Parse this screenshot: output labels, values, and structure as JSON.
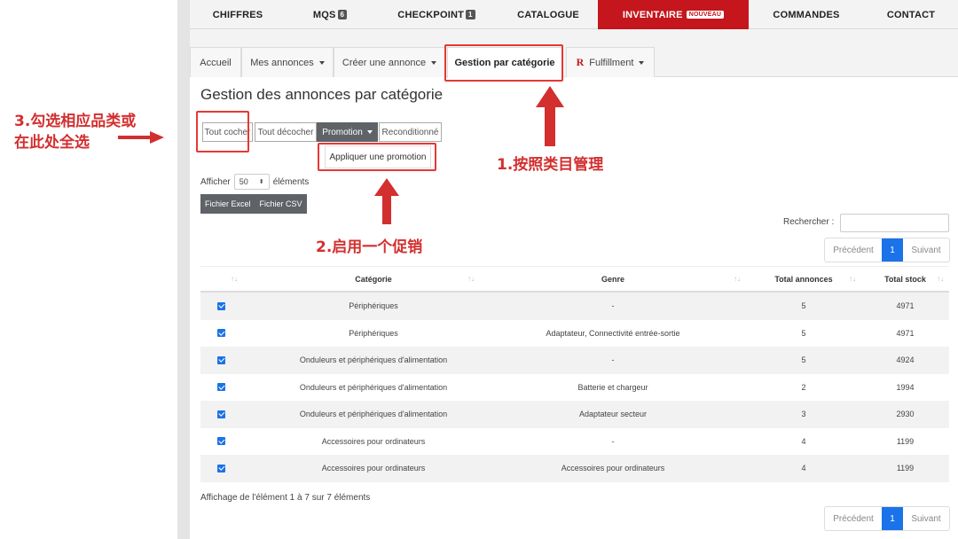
{
  "nav": {
    "items": [
      {
        "label": "CHIFFRES",
        "badge": ""
      },
      {
        "label": "MQS",
        "badge": "6"
      },
      {
        "label": "CHECKPOINT",
        "badge": "1"
      },
      {
        "label": "CATALOGUE",
        "badge": ""
      },
      {
        "label": "INVENTAIRE",
        "badge": "NOUVEAU"
      },
      {
        "label": "COMMANDES",
        "badge": ""
      },
      {
        "label": "CONTACT",
        "badge": ""
      }
    ]
  },
  "tabs": [
    {
      "label": "Accueil"
    },
    {
      "label": "Mes annonces"
    },
    {
      "label": "Créer une annonce"
    },
    {
      "label": "Gestion par catégorie"
    },
    {
      "label": "Fulfillment",
      "logo": "R"
    }
  ],
  "page_title": "Gestion des annonces par catégorie",
  "actions": {
    "check_all": "Tout cocher",
    "uncheck_all": "Tout décocher",
    "promotion": "Promotion",
    "refurbished": "Reconditionné",
    "apply_promotion": "Appliquer une promotion"
  },
  "length": {
    "prefix": "Afficher",
    "value": "50",
    "suffix": "éléments"
  },
  "export": {
    "excel": "Fichier Excel",
    "csv": "Fichier CSV"
  },
  "search": {
    "label": "Rechercher :"
  },
  "pagination": {
    "prev": "Précédent",
    "page": "1",
    "next": "Suivant"
  },
  "table": {
    "sort_icon": "↑↓",
    "headers": [
      "Catégorie",
      "Genre",
      "Total annonces",
      "Total stock"
    ],
    "rows": [
      {
        "checked": true,
        "categorie": "Périphériques",
        "genre": "-",
        "total_annonces": "5",
        "total_stock": "4971"
      },
      {
        "checked": true,
        "categorie": "Périphériques",
        "genre": "Adaptateur, Connectivité entrée-sortie",
        "total_annonces": "5",
        "total_stock": "4971"
      },
      {
        "checked": true,
        "categorie": "Onduleurs et périphériques d'alimentation",
        "genre": "-",
        "total_annonces": "5",
        "total_stock": "4924"
      },
      {
        "checked": true,
        "categorie": "Onduleurs et périphériques d'alimentation",
        "genre": "Batterie et chargeur",
        "total_annonces": "2",
        "total_stock": "1994"
      },
      {
        "checked": true,
        "categorie": "Onduleurs et périphériques d'alimentation",
        "genre": "Adaptateur secteur",
        "total_annonces": "3",
        "total_stock": "2930"
      },
      {
        "checked": true,
        "categorie": "Accessoires pour ordinateurs",
        "genre": "-",
        "total_annonces": "4",
        "total_stock": "1199"
      },
      {
        "checked": true,
        "categorie": "Accessoires pour ordinateurs",
        "genre": "Accessoires pour ordinateurs",
        "total_annonces": "4",
        "total_stock": "1199"
      }
    ]
  },
  "footer_info": "Affichage de l'élément 1 à 7 sur 7 éléments",
  "annotations": {
    "step3_line1": "3.勾选相应品类或",
    "step3_line2": "在此处全选",
    "step1": "1.按照类目管理",
    "step2": "2.启用一个促销",
    "color": "#e53935"
  },
  "colors": {
    "brand": "#c4161c",
    "accent": "#1a73e8",
    "button_dark": "#5f6368"
  }
}
